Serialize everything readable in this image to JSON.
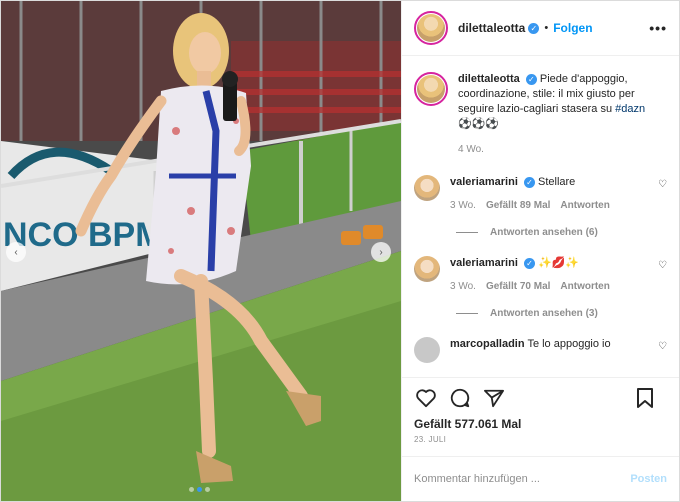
{
  "post": {
    "username": "dilettaleotta",
    "follow_label": "Folgen",
    "caption": "Piede d'appoggio, coordinazione, stile: il mix giusto per seguire lazio-cagliari stasera su",
    "hashtag": "#dazn",
    "emojis": "⚽⚽⚽",
    "caption_time": "4 Wo.",
    "likes": "Gefällt 577.061 Mal",
    "date": "23. JULI",
    "comment_placeholder": "Kommentar hinzufügen ...",
    "post_label": "Posten"
  },
  "comments": [
    {
      "username": "valeriamarini",
      "text": "Stellare",
      "time": "3 Wo.",
      "likes": "Gefällt 89 Mal",
      "reply_label": "Antworten",
      "replies_label": "Antworten ansehen (6)"
    },
    {
      "username": "valeriamarini",
      "text": "✨💋✨",
      "time": "3 Wo.",
      "likes": "Gefällt 70 Mal",
      "reply_label": "Antworten",
      "replies_label": "Antworten ansehen (3)"
    },
    {
      "username": "marcopalladin",
      "text": "Te lo appoggio io"
    }
  ],
  "icons": {
    "verified": "verified-icon",
    "more": "more-icon",
    "like": "heart-icon",
    "comment": "comment-icon",
    "share": "share-icon",
    "save": "bookmark-icon"
  },
  "colors": {
    "accent": "#0095f6",
    "verified": "#3897f0"
  },
  "media": {
    "banner_text": "NCO BPM"
  }
}
